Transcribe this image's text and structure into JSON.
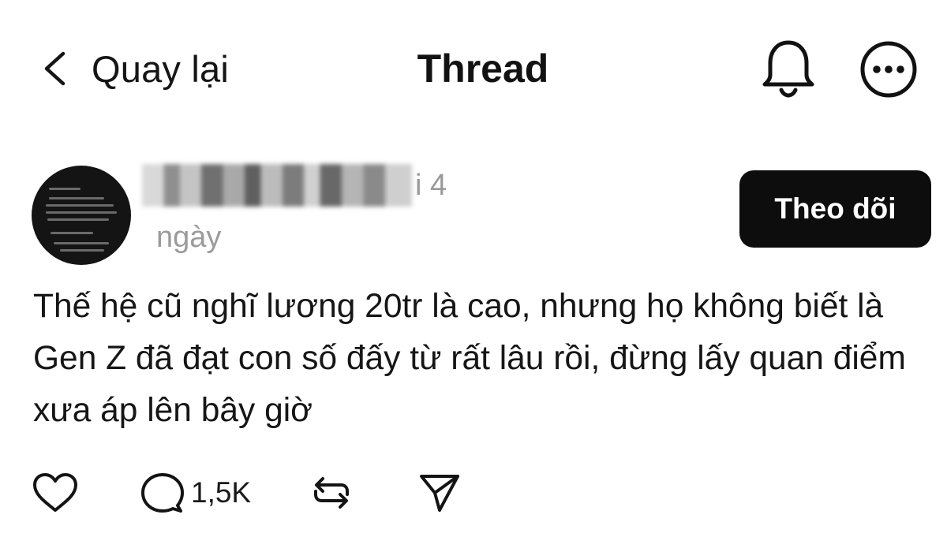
{
  "header": {
    "back_label": "Quay lại",
    "title": "Thread",
    "icons": [
      "chevron-left-icon",
      "bell-icon",
      "more-icon"
    ]
  },
  "post": {
    "username_tail": "i 4",
    "time": "ngày",
    "follow_label": "Theo dõi",
    "text": "Thế hệ cũ nghĩ lương 20tr là cao, nhưng họ không biết là Gen Z đã đạt con số đấy từ rất lâu rồi, đừng lấy quan điểm xưa áp lên bây giờ"
  },
  "actions": {
    "reply_count": "1,5K",
    "icons": [
      "heart-icon",
      "comment-icon",
      "repost-icon",
      "share-icon"
    ]
  }
}
